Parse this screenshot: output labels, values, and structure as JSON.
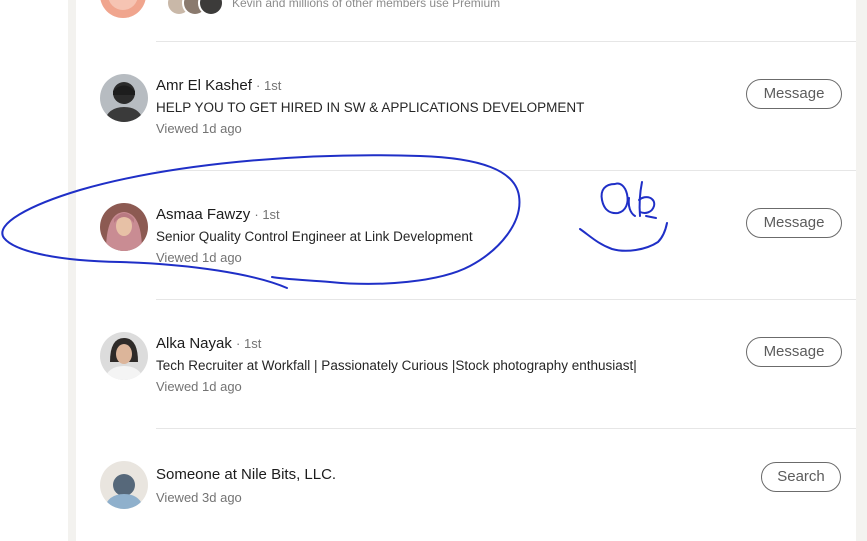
{
  "premium_row": {
    "text": "Kevin and millions of other members use Premium"
  },
  "entries": [
    {
      "name": "Amr El Kashef",
      "degree": "· 1st",
      "headline": "HELP YOU TO GET HIRED IN SW & APPLICATIONS DEVELOPMENT",
      "viewed": "Viewed 1d ago",
      "action": "Message"
    },
    {
      "name": "Asmaa Fawzy",
      "degree": "· 1st",
      "headline": "Senior Quality Control Engineer at Link Development",
      "viewed": "Viewed 1d ago",
      "action": "Message"
    },
    {
      "name": "Alka Nayak",
      "degree": "· 1st",
      "headline": "Tech Recruiter at Workfall | Passionately Curious |Stock photography enthusiast|",
      "viewed": "Viewed 1d ago",
      "action": "Message"
    },
    {
      "name": "Someone at Nile Bits, LLC.",
      "viewed": "Viewed 3d ago",
      "action": "Search"
    }
  ],
  "colors": {
    "annotation_ink": "#1f2fc7",
    "premium_button": "#f8c77e",
    "page_background": "#f3f2ef"
  },
  "icons": {
    "annotation": "handwritten-ink-circle-and-scribble"
  }
}
